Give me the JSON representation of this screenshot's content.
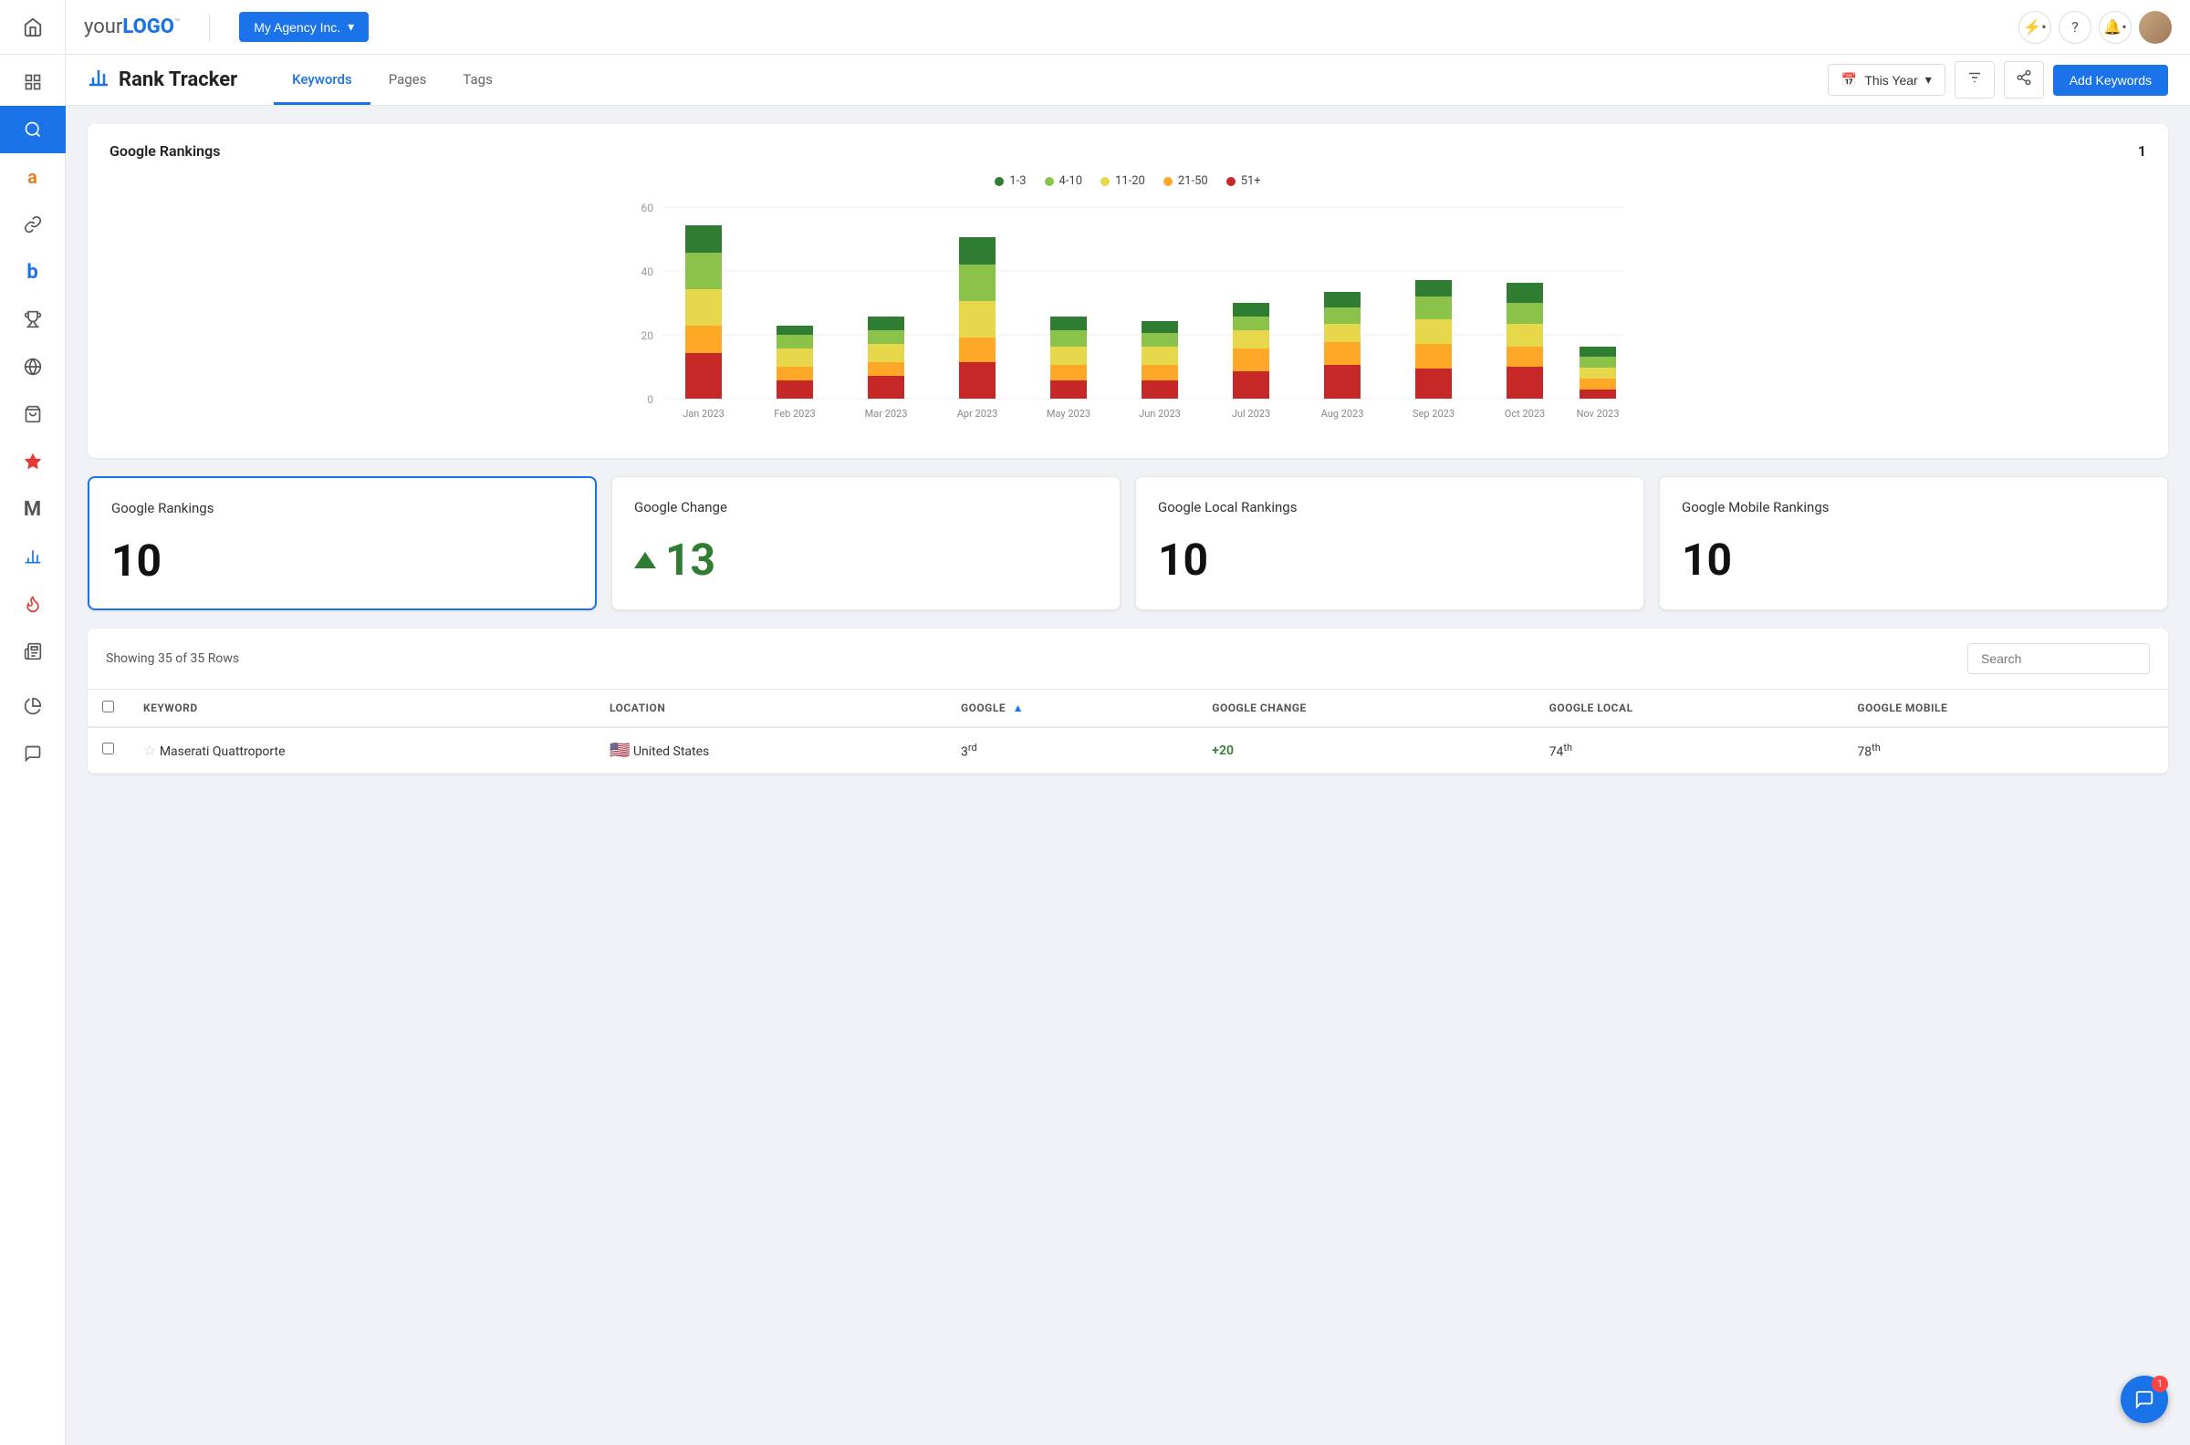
{
  "app": {
    "logo": "yourLOGO",
    "logo_tm": "™",
    "agency": "My Agency Inc.",
    "nav_icons": [
      "home",
      "grid",
      "search",
      "tag",
      "link",
      "b-icon",
      "trophy",
      "globe",
      "bag",
      "star",
      "m-icon",
      "chart-bar",
      "flame",
      "newspaper"
    ]
  },
  "header": {
    "title": "Rank Tracker",
    "tabs": [
      "Keywords",
      "Pages",
      "Tags"
    ],
    "active_tab": "Keywords",
    "date_filter": "This Year",
    "add_keywords_label": "Add Keywords"
  },
  "chart": {
    "title": "Google Rankings",
    "number": "1",
    "legend": [
      {
        "label": "1-3",
        "color": "#2e7d32"
      },
      {
        "label": "4-10",
        "color": "#8bc34a"
      },
      {
        "label": "11-20",
        "color": "#ffeb3b"
      },
      {
        "label": "21-50",
        "color": "#ffa726"
      },
      {
        "label": "51+",
        "color": "#c62828"
      }
    ],
    "months": [
      "Jan 2023",
      "Feb 2023",
      "Mar 2023",
      "Apr 2023",
      "May 2023",
      "Jun 2023",
      "Jul 2023",
      "Aug 2023",
      "Sep 2023",
      "Oct 2023",
      "Nov 2023"
    ],
    "bars": [
      {
        "v1": 6,
        "v2": 8,
        "v3": 8,
        "v4": 6,
        "v5": 10
      },
      {
        "v1": 2,
        "v2": 3,
        "v3": 4,
        "v4": 3,
        "v5": 2
      },
      {
        "v1": 3,
        "v2": 4,
        "v3": 5,
        "v4": 2,
        "v5": 3
      },
      {
        "v1": 5,
        "v2": 8,
        "v3": 7,
        "v4": 6,
        "v5": 8
      },
      {
        "v1": 3,
        "v2": 4,
        "v3": 4,
        "v4": 4,
        "v5": 4
      },
      {
        "v1": 2,
        "v2": 4,
        "v3": 4,
        "v4": 3,
        "v5": 4
      },
      {
        "v1": 3,
        "v2": 4,
        "v3": 5,
        "v4": 5,
        "v5": 6
      },
      {
        "v1": 4,
        "v2": 5,
        "v3": 5,
        "v4": 5,
        "v5": 8
      },
      {
        "v1": 3,
        "v2": 5,
        "v3": 6,
        "v4": 5,
        "v5": 8
      },
      {
        "v1": 3,
        "v2": 5,
        "v3": 5,
        "v4": 5,
        "v5": 8
      },
      {
        "v1": 1,
        "v2": 3,
        "v3": 2,
        "v4": 1,
        "v5": 1
      }
    ]
  },
  "metrics": [
    {
      "label": "Google Rankings",
      "value": "10",
      "type": "normal",
      "selected": true
    },
    {
      "label": "Google Change",
      "value": "13",
      "type": "positive"
    },
    {
      "label": "Google Local Rankings",
      "value": "10",
      "type": "normal"
    },
    {
      "label": "Google Mobile Rankings",
      "value": "10",
      "type": "normal"
    }
  ],
  "table": {
    "info": "Showing 35 of 35 Rows",
    "search_placeholder": "Search",
    "columns": [
      "KEYWORD",
      "LOCATION",
      "GOOGLE",
      "GOOGLE CHANGE",
      "GOOGLE LOCAL",
      "GOOGLE MOBILE"
    ],
    "rows": [
      {
        "keyword": "Maserati Quattroporte",
        "location": "United States",
        "flag": "🇺🇸",
        "google": "3",
        "google_sup": "rd",
        "google_change": "+20",
        "google_local": "74",
        "google_local_sup": "th",
        "google_mobile": "78",
        "google_mobile_sup": "th"
      }
    ]
  }
}
